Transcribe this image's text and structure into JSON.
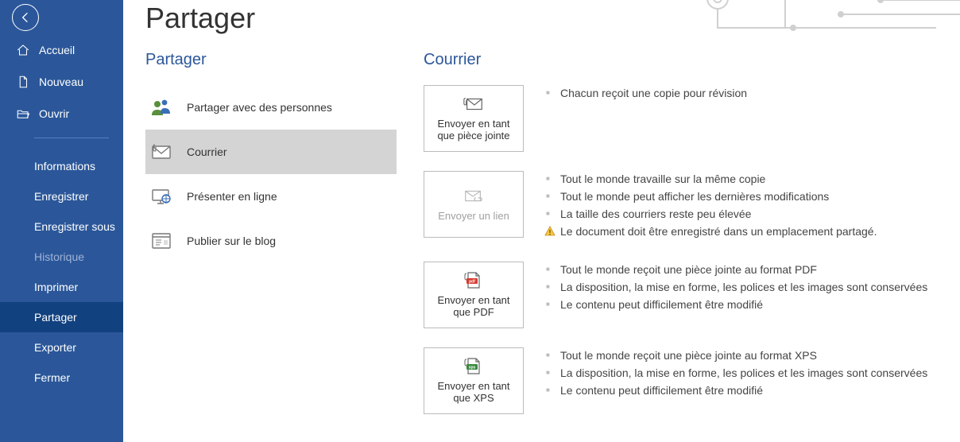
{
  "sidebar": {
    "primary": [
      {
        "label": "Accueil"
      },
      {
        "label": "Nouveau"
      },
      {
        "label": "Ouvrir"
      }
    ],
    "secondary": [
      {
        "label": "Informations"
      },
      {
        "label": "Enregistrer"
      },
      {
        "label": "Enregistrer sous"
      },
      {
        "label": "Historique",
        "disabled": true
      },
      {
        "label": "Imprimer"
      },
      {
        "label": "Partager",
        "selected": true
      },
      {
        "label": "Exporter"
      },
      {
        "label": "Fermer"
      }
    ]
  },
  "page": {
    "title": "Partager"
  },
  "shareList": {
    "heading": "Partager",
    "items": [
      {
        "label": "Partager avec des personnes"
      },
      {
        "label": "Courrier",
        "selected": true
      },
      {
        "label": "Présenter en ligne"
      },
      {
        "label": "Publier sur le blog"
      }
    ]
  },
  "mail": {
    "heading": "Courrier",
    "options": [
      {
        "tileLabel": "Envoyer en tant que pièce jointe",
        "bullets": [
          "Chacun reçoit une copie pour révision"
        ]
      },
      {
        "tileLabel": "Envoyer un lien",
        "disabled": true,
        "bullets": [
          "Tout le monde travaille sur la même copie",
          "Tout le monde peut afficher les dernières modifications",
          "La taille des courriers reste peu élevée"
        ],
        "warning": "Le document doit être enregistré dans un emplacement partagé."
      },
      {
        "tileLabel": "Envoyer en tant que PDF",
        "bullets": [
          "Tout le monde reçoit une pièce jointe au format PDF",
          "La disposition, la mise en forme, les polices et les images sont conservées",
          "Le contenu peut difficilement être modifié"
        ]
      },
      {
        "tileLabel": "Envoyer en tant que XPS",
        "bullets": [
          "Tout le monde reçoit une pièce jointe au format XPS",
          "La disposition, la mise en forme, les polices et les images sont conservées",
          "Le contenu peut difficilement être modifié"
        ]
      }
    ]
  }
}
